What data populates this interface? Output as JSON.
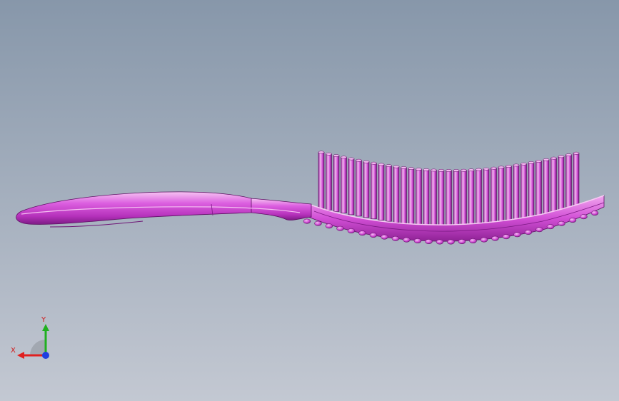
{
  "viewport": {
    "background_top": "#8797aa",
    "background_bottom": "#c3c8d2"
  },
  "model": {
    "body_color": "#d24fd6",
    "highlight_color": "#f3b8f0",
    "shadow_color": "#8a1f90",
    "edge_color": "#5d1063"
  },
  "triad": {
    "x_label": "X",
    "y_label": "Y",
    "x_color": "#e02020",
    "y_color": "#20b020",
    "z_color": "#2040e0",
    "label_color": "#d01818"
  }
}
